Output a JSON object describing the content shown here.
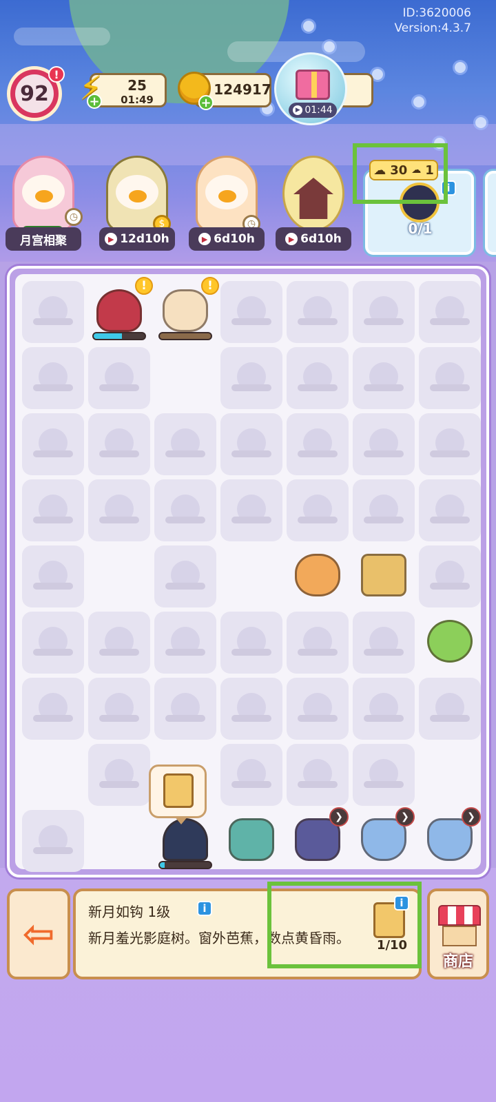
{
  "header": {
    "id_text": "ID:3620006",
    "version_text": "Version:4.3.7"
  },
  "top_bar": {
    "level": "92",
    "level_alert": "!",
    "energy": {
      "value": "25",
      "timer": "01:49",
      "icon": "lightning-icon"
    },
    "coins": {
      "value": "124917",
      "icon": "coin-icon"
    },
    "gift": {
      "timer": "01:44",
      "icon": "gift-box-icon"
    }
  },
  "events": [
    {
      "label": "月宫相聚",
      "character": "moon-palace-girl"
    },
    {
      "label": "12d10h",
      "character": "turban-duck"
    },
    {
      "label": "6d10h",
      "character": "bunny-duck"
    },
    {
      "label": "6d10h",
      "character": "pagoda-moon"
    }
  ],
  "order": {
    "reward_text": "30",
    "reward_secondary": "1",
    "count": "0/1",
    "info": "i"
  },
  "board": {
    "cells": [
      [
        "empty",
        "red-pot",
        "bunny-baker",
        "empty",
        "empty",
        "empty",
        "empty"
      ],
      [
        "empty",
        "empty",
        "blank",
        "empty",
        "empty",
        "empty",
        "empty"
      ],
      [
        "empty",
        "empty",
        "empty",
        "empty",
        "empty",
        "empty",
        "empty"
      ],
      [
        "empty",
        "empty",
        "empty",
        "empty",
        "empty",
        "empty",
        "empty"
      ],
      [
        "empty",
        "blank",
        "empty",
        "blank",
        "mooncake",
        "lantern-box",
        "empty"
      ],
      [
        "empty",
        "empty",
        "empty",
        "empty",
        "empty",
        "empty",
        "green-dumplings"
      ],
      [
        "empty",
        "empty",
        "empty",
        "empty",
        "empty",
        "empty",
        "empty"
      ],
      [
        "blank",
        "empty",
        "blank",
        "empty",
        "empty",
        "empty",
        "blank"
      ],
      [
        "empty",
        "blank",
        "moon-door",
        "tree-shrine",
        "star-jar",
        "bowl-water",
        "bowl-water"
      ]
    ]
  },
  "selected_item": {
    "title": "新月如钩 1级",
    "description": "新月羞光影庭树。窗外芭蕉，数点黄昏雨。",
    "progress": "1/10",
    "info": "i"
  },
  "buttons": {
    "shop_label": "商店",
    "exit_icon": "exit-door-icon"
  },
  "colors": {
    "highlight": "#6bc23c",
    "board_bg": "#f6f4fa",
    "accent_purple": "#bba0e6"
  }
}
